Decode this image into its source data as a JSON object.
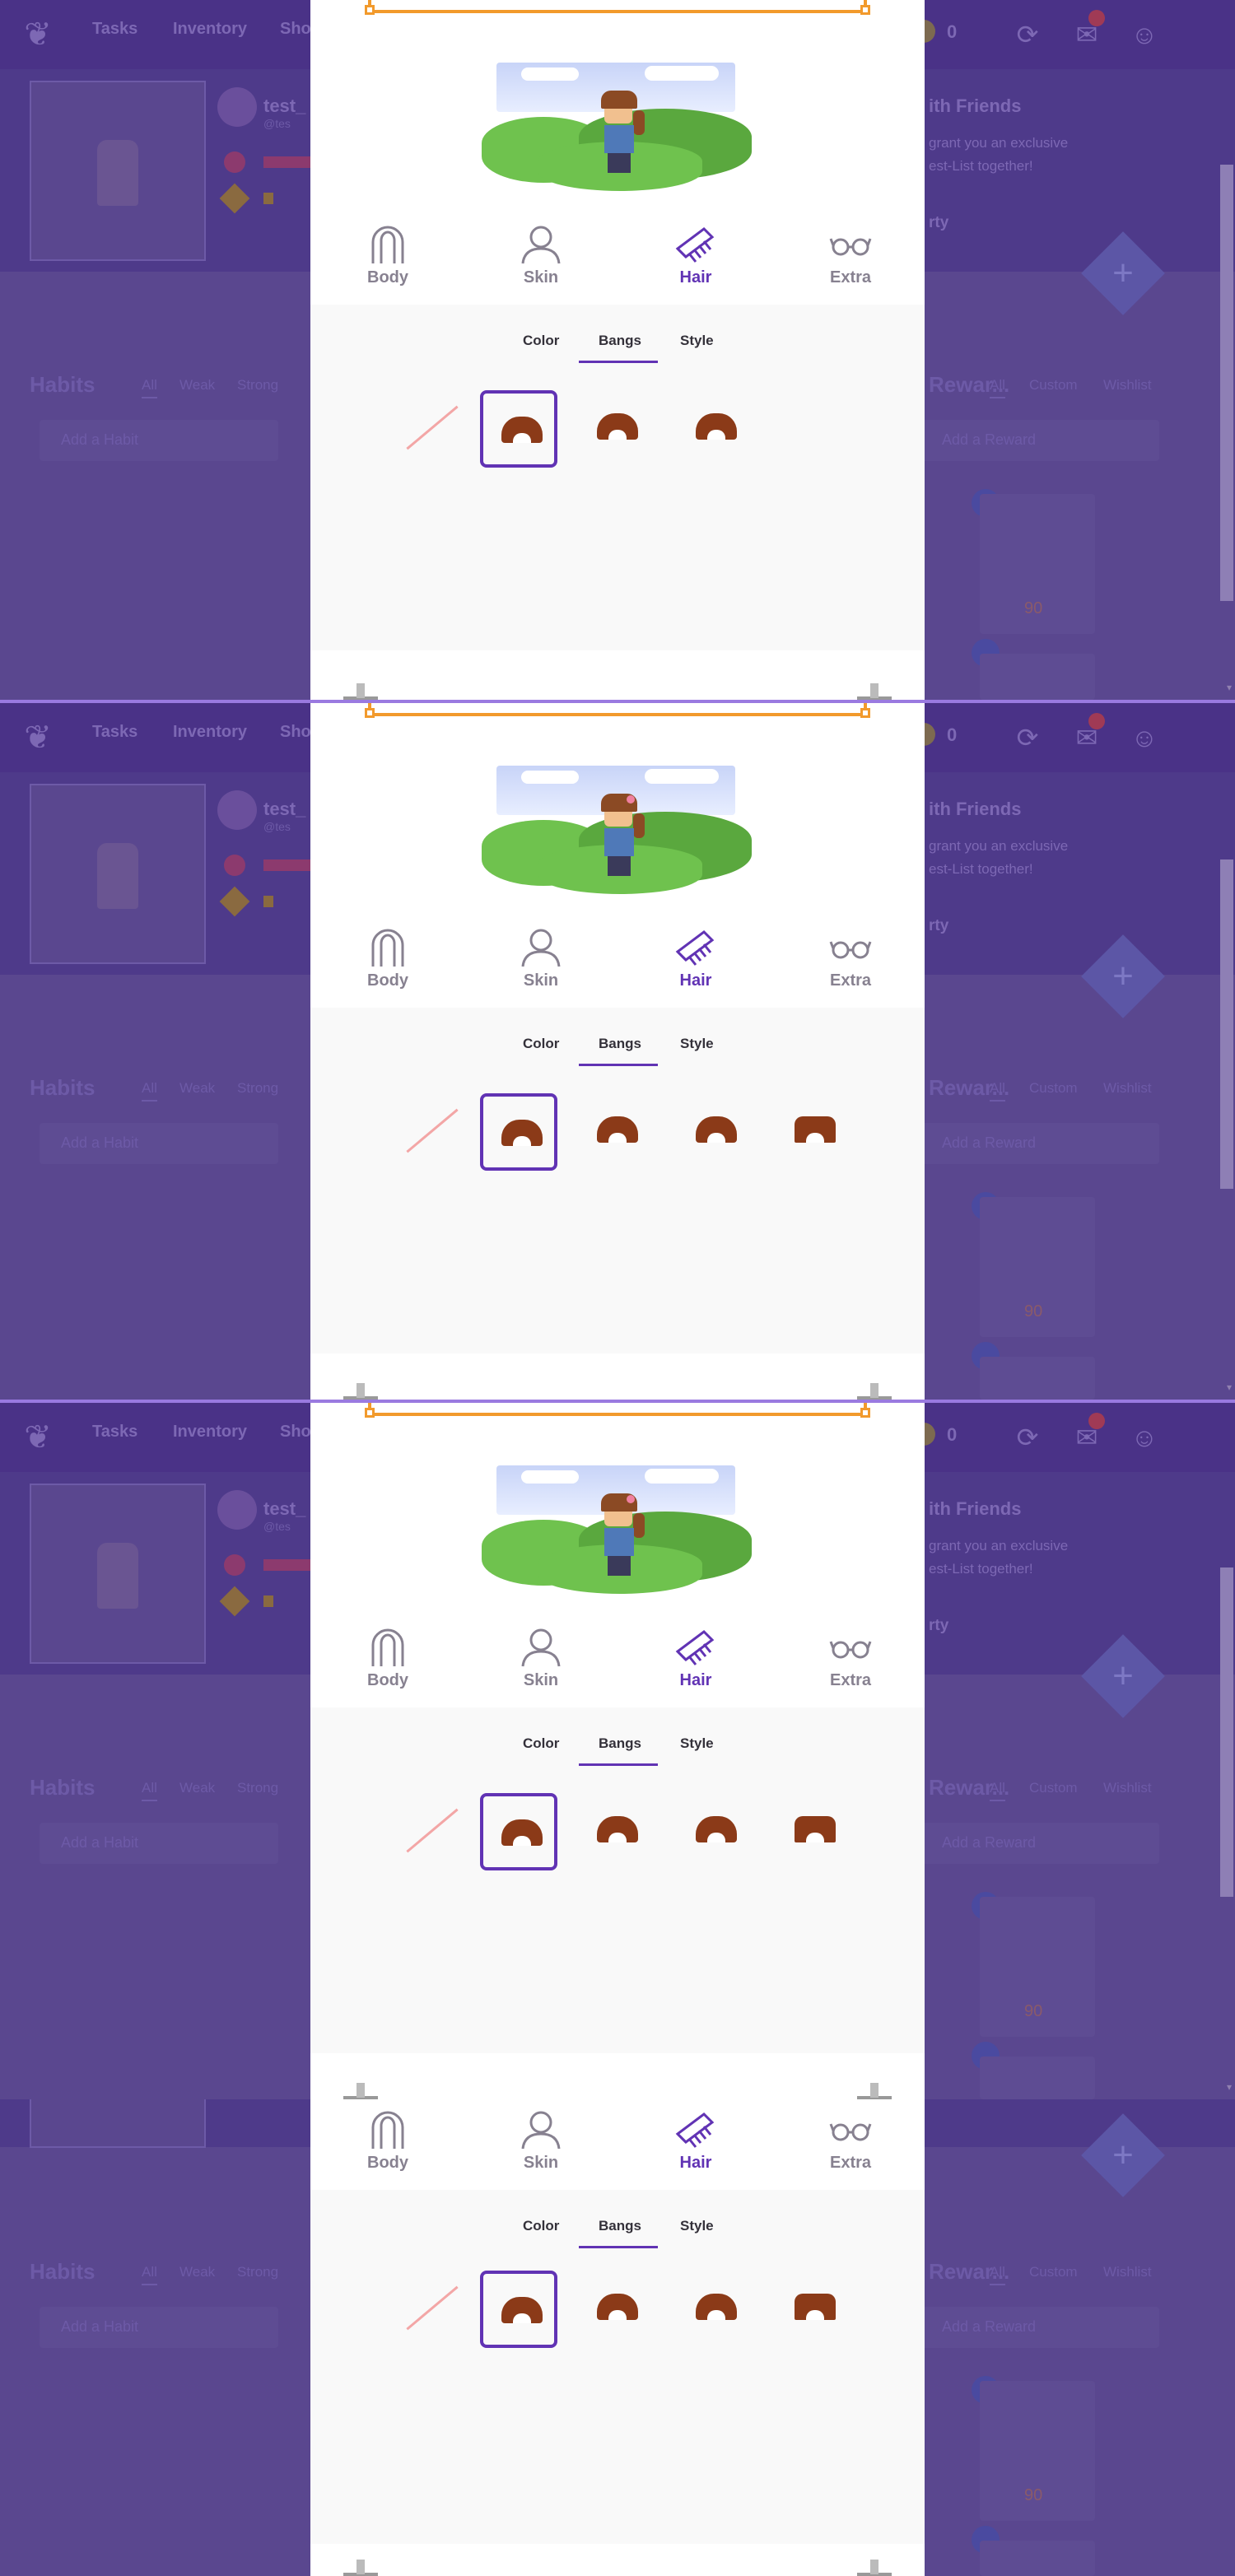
{
  "nav": {
    "tasks": "Tasks",
    "inventory": "Inventory",
    "shop": "Sho",
    "gold": "0"
  },
  "profile": {
    "name": "test_",
    "handle": "@tes"
  },
  "party": {
    "title": "ith Friends",
    "line1": "grant you an exclusive",
    "line2": "est-List together!",
    "link": "rty"
  },
  "habits": {
    "title": "Habits",
    "filters": [
      "All",
      "Weak",
      "Strong"
    ],
    "add_placeholder": "Add a Habit"
  },
  "rewards": {
    "title": "Rewar...",
    "filters": [
      "All",
      "Custom",
      "Wishlist"
    ],
    "add_placeholder": "Add a Reward",
    "price": "90"
  },
  "customizer": {
    "categories": [
      "Body",
      "Skin",
      "Hair",
      "Extra"
    ],
    "subtabs": [
      "Color",
      "Bangs",
      "Style"
    ]
  },
  "colors": {
    "accent": "#6133b4",
    "border": "#f29a2c"
  }
}
